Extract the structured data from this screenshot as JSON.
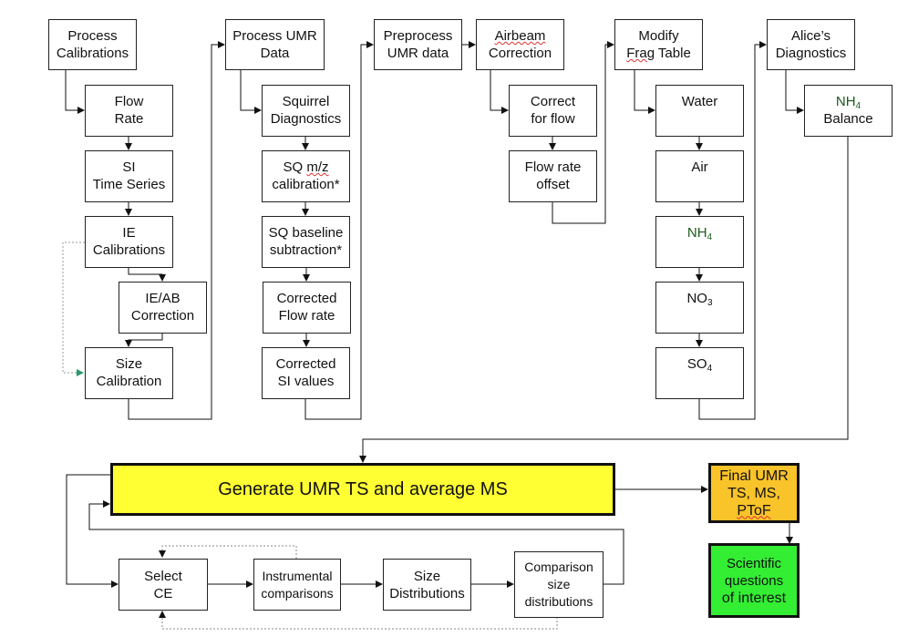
{
  "colors": {
    "generate": "#ffff33",
    "final": "#f9c32a",
    "scientific": "#33ee33",
    "nh4_text": "#1a5a1a"
  },
  "col1": {
    "head": [
      "Process",
      "Calibrations"
    ],
    "items": [
      [
        "Flow",
        "Rate"
      ],
      [
        "SI",
        "Time Series"
      ],
      [
        "IE",
        "Calibrations"
      ],
      [
        "IE/AB",
        "Correction"
      ],
      [
        "Size",
        "Calibration"
      ]
    ]
  },
  "col2": {
    "head": [
      "Process UMR",
      "Data"
    ],
    "items": [
      [
        "Squirrel",
        "Diagnostics"
      ],
      [
        "SQ ",
        "m/z",
        "calibration*"
      ],
      [
        "SQ baseline",
        "subtraction*"
      ],
      [
        "Corrected",
        "Flow rate"
      ],
      [
        "Corrected",
        "SI values"
      ]
    ]
  },
  "col3": {
    "head": [
      "Preprocess",
      "UMR data"
    ]
  },
  "col4": {
    "head": [
      "Airbeam",
      "Correction"
    ],
    "items": [
      [
        "Correct",
        "for flow"
      ],
      [
        "Flow rate",
        "offset"
      ]
    ]
  },
  "col5": {
    "head": [
      "Modify",
      "Frag",
      " Table"
    ],
    "items": [
      {
        "main": "Water"
      },
      {
        "main": "Air"
      },
      {
        "main": "NH",
        "sub": "4"
      },
      {
        "main": "NO",
        "sub": "3"
      },
      {
        "main": "SO",
        "sub": "4"
      }
    ]
  },
  "col6": {
    "head": [
      "Alice’s",
      "Diagnostics"
    ],
    "items": [
      {
        "main": "NH",
        "sub": "4",
        "line2": "Balance"
      }
    ]
  },
  "generate": "Generate UMR TS and average MS",
  "final": [
    "Final UMR",
    "TS, MS, ",
    "PToF"
  ],
  "scientific": [
    "Scientific questions",
    "of interest"
  ],
  "loop": [
    [
      "Select",
      "CE"
    ],
    [
      "Instrumental",
      "comparisons"
    ],
    [
      "Size",
      "Distributions"
    ],
    [
      "Comparison",
      "size",
      "distributions"
    ]
  ]
}
